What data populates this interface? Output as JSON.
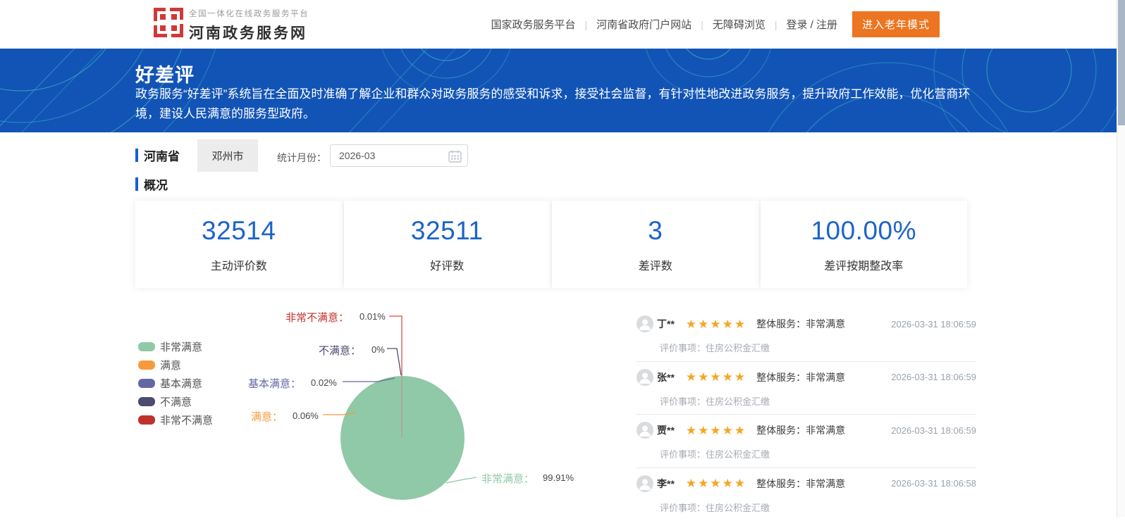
{
  "header": {
    "logo": {
      "platform_text": "全国一体化在线政务服务平台",
      "site_name": "河南政务服务网"
    },
    "nav": [
      "国家政务服务平台",
      "河南省政府门户网站",
      "无障碍浏览",
      "登录 / 注册"
    ],
    "separator": "|",
    "elder_mode_button": "进入老年模式"
  },
  "banner": {
    "title": "好差评",
    "description": "政务服务“好差评”系统旨在全面及时准确了解企业和群众对政务服务的感受和诉求，接受社会监督，有针对性地改进政务服务，提升政府工作效能，优化营商环境，建设人民满意的服务型政府。"
  },
  "filters": {
    "province": "河南省",
    "city": "邓州市",
    "month_label": "统计月份：",
    "month_value": "2026-03"
  },
  "overview": {
    "section_title": "概况",
    "stats": [
      {
        "value": "32514",
        "label": "主动评价数"
      },
      {
        "value": "32511",
        "label": "好评数"
      },
      {
        "value": "3",
        "label": "差评数"
      },
      {
        "value": "100.00%",
        "label": "差评按期整改率"
      }
    ]
  },
  "chart_data": {
    "type": "pie",
    "categories": [
      "非常满意",
      "满意",
      "基本满意",
      "不满意",
      "非常不满意"
    ],
    "values": [
      99.91,
      0.06,
      0.02,
      0,
      0.01
    ],
    "unit": "%",
    "colors": [
      "#8fc9a8",
      "#f79a3e",
      "#6567a5",
      "#4c4c70",
      "#c0302d"
    ],
    "legend_position": "left",
    "labels": [
      {
        "name": "非常满意：",
        "value": "99.91%"
      },
      {
        "name": "满意：",
        "value": "0.06%"
      },
      {
        "name": "基本满意：",
        "value": "0.02%"
      },
      {
        "name": "不满意：",
        "value": "0%"
      },
      {
        "name": "非常不满意：",
        "value": "0.01%"
      }
    ]
  },
  "reviews": [
    {
      "name": "丁**",
      "stars": "★★★★★",
      "overall_label": "整体服务：",
      "overall_value": "非常满意",
      "time": "2026-03-31 18:06:59",
      "item": "评价事项：住房公积金汇缴"
    },
    {
      "name": "张**",
      "stars": "★★★★★",
      "overall_label": "整体服务：",
      "overall_value": "非常满意",
      "time": "2026-03-31 18:06:59",
      "item": "评价事项：住房公积金汇缴"
    },
    {
      "name": "贾**",
      "stars": "★★★★★",
      "overall_label": "整体服务：",
      "overall_value": "非常满意",
      "time": "2026-03-31 18:06:59",
      "item": "评价事项：住房公积金汇缴"
    },
    {
      "name": "李**",
      "stars": "★★★★★",
      "overall_label": "整体服务：",
      "overall_value": "非常满意",
      "time": "2026-03-31 18:06:58",
      "item": "评价事项：住房公积金汇缴"
    }
  ]
}
